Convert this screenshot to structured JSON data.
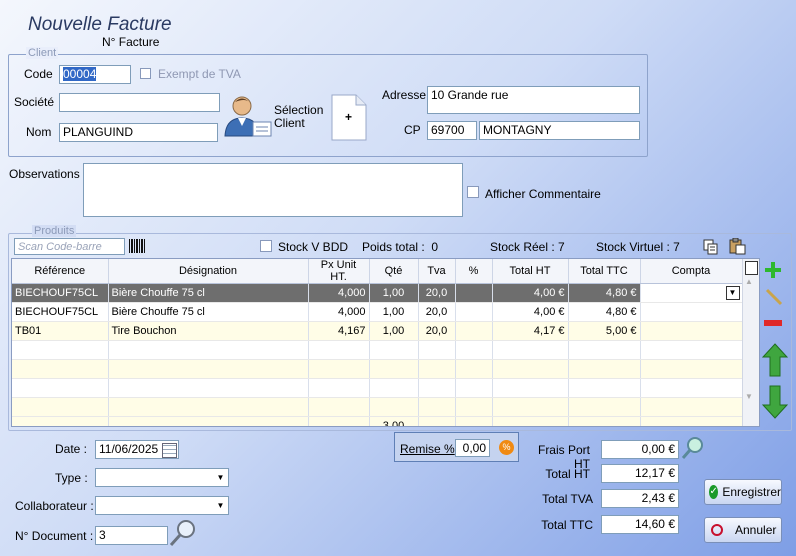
{
  "header": {
    "title": "Nouvelle Facture",
    "subtitle": "N° Facture"
  },
  "client": {
    "group_label": "Client",
    "code_label": "Code",
    "code_value": "00004",
    "exempt_label": "Exempt de TVA",
    "societe_label": "Société",
    "societe_value": "",
    "nom_label": "Nom",
    "nom_value": "PLANGUIND",
    "selection_label": "Sélection Client",
    "add_symbol": "+",
    "adresse_label": "Adresse",
    "adresse_value": "10 Grande rue",
    "cp_label": "CP",
    "cp_value": "69700",
    "ville_value": "MONTAGNY"
  },
  "observations": {
    "label": "Observations",
    "value": "",
    "comment_label": "Afficher Commentaire"
  },
  "produits": {
    "group_label": "Produits",
    "scan_placeholder": "Scan Code-barre",
    "stock_bdd_label": "Stock V BDD",
    "poids_total": "Poids total :  0",
    "stock_reel": "Stock Réel : 7",
    "stock_virtuel": "Stock Virtuel : 7",
    "columns": [
      "Référence",
      "Désignation",
      "Px Unit HT.",
      "Qté",
      "Tva",
      "%",
      "Total HT",
      "Total TTC",
      "Compta"
    ],
    "rows": [
      {
        "ref": "BIECHOUF75CL",
        "designation": "Bière Chouffe 75 cl",
        "px": "4,000",
        "qte": "1,00",
        "tva": "20,0",
        "pct": "",
        "total_ht": "4,00 €",
        "total_ttc": "4,80 €",
        "compta": ""
      },
      {
        "ref": "BIECHOUF75CL",
        "designation": "Bière Chouffe 75 cl",
        "px": "4,000",
        "qte": "1,00",
        "tva": "20,0",
        "pct": "",
        "total_ht": "4,00 €",
        "total_ttc": "4,80 €",
        "compta": ""
      },
      {
        "ref": "TB01",
        "designation": "Tire Bouchon",
        "px": "4,167",
        "qte": "1,00",
        "tva": "20,0",
        "pct": "",
        "total_ht": "4,17 €",
        "total_ttc": "5,00 €",
        "compta": ""
      }
    ],
    "qte_total": "3,00"
  },
  "footer": {
    "date_label": "Date :",
    "date_value": "11/06/2025",
    "type_label": "Type :",
    "collab_label": "Collaborateur :",
    "doc_label": "N° Document :",
    "doc_value": "3",
    "remise_label": "Remise %",
    "remise_value": "0,00",
    "frais_label": "Frais Port HT",
    "frais_value": "0,00 €",
    "total_ht_label": "Total HT",
    "total_ht_value": "12,17 €",
    "total_tva_label": "Total TVA",
    "total_tva_value": "2,43 €",
    "total_ttc_label": "Total TTC",
    "total_ttc_value": "14,60 €",
    "save_label": "Enregistrer",
    "cancel_label": "Annuler"
  },
  "colors": {
    "save_check": "#1a9a2a",
    "cancel_icon": "#c8102e",
    "add_green": "#2eb82e",
    "remove_red": "#e02828"
  }
}
